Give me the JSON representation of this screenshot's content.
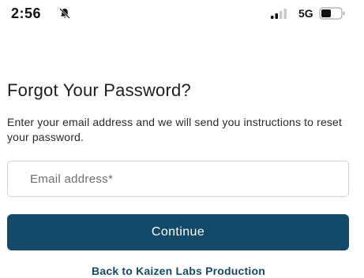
{
  "status_bar": {
    "time": "2:56",
    "network": "5G",
    "icons": [
      "bell-muted-icon",
      "signal-icon",
      "battery-icon"
    ]
  },
  "form": {
    "title": "Forgot Your Password?",
    "description": "Enter your email address and we will send you instructions to reset your password.",
    "email_placeholder": "Email address*",
    "email_value": "",
    "continue_label": "Continue",
    "back_link_label": "Back to Kaizen Labs Production"
  },
  "colors": {
    "primary": "#134a69",
    "background": "#ffffff",
    "field_border": "#cfd3d7"
  }
}
